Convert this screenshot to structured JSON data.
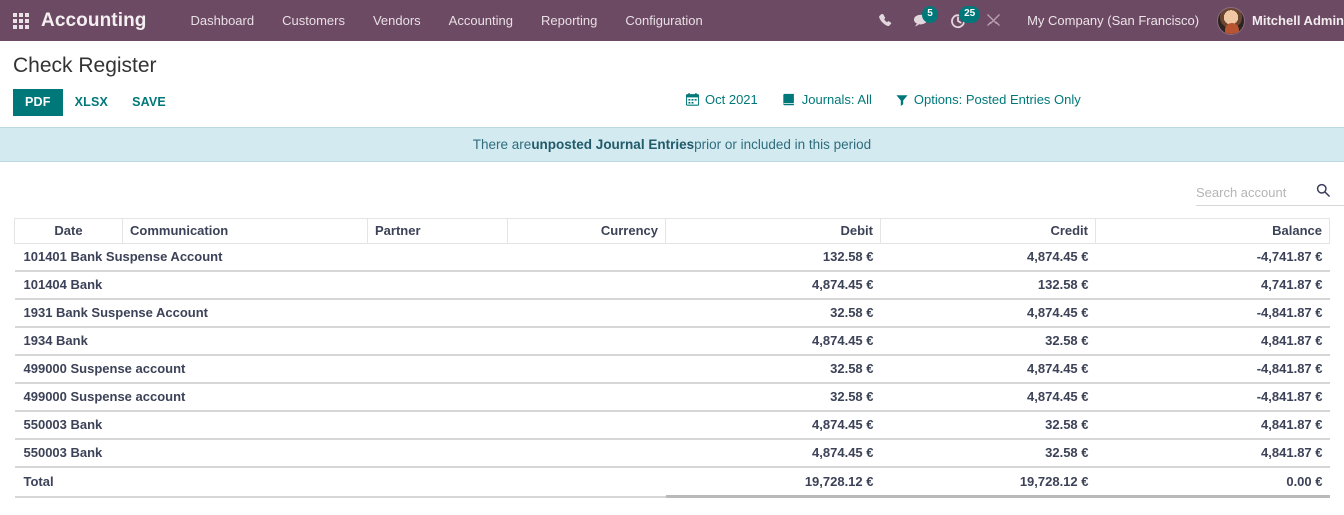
{
  "navbar": {
    "apps_icon": "apps-grid-icon",
    "brand": "Accounting",
    "menu": [
      {
        "label": "Dashboard"
      },
      {
        "label": "Customers"
      },
      {
        "label": "Vendors"
      },
      {
        "label": "Accounting"
      },
      {
        "label": "Reporting"
      },
      {
        "label": "Configuration"
      }
    ],
    "icons": {
      "phone": "phone-icon",
      "messages": "chat-icon",
      "messages_count": "5",
      "activities": "activity-clock-icon",
      "activities_count": "25",
      "tools": "wrench-screwdriver-icon"
    },
    "company": "My Company (San Francisco)",
    "user": "Mitchell Admin",
    "avatar": "user-avatar"
  },
  "page": {
    "title": "Check Register"
  },
  "toolbar": {
    "pdf_label": "PDF",
    "xlsx_label": "XLSX",
    "save_label": "SAVE"
  },
  "filters": [
    {
      "icon": "calendar-icon",
      "label": "Oct 2021"
    },
    {
      "icon": "book-icon",
      "label": "Journals: All"
    },
    {
      "icon": "filter-icon",
      "label": "Options: Posted Entries Only"
    }
  ],
  "alert": {
    "prefix": "There are ",
    "strong": "unposted Journal Entries",
    "suffix": " prior or included in this period"
  },
  "search": {
    "placeholder": "Search account",
    "value": "",
    "icon": "search-icon"
  },
  "table": {
    "headers": {
      "date": "Date",
      "communication": "Communication",
      "partner": "Partner",
      "currency": "Currency",
      "debit": "Debit",
      "credit": "Credit",
      "balance": "Balance"
    },
    "rows": [
      {
        "account": "101401 Bank Suspense Account",
        "debit": "132.58 €",
        "credit": "4,874.45 €",
        "balance": "-4,741.87 €"
      },
      {
        "account": "101404 Bank",
        "debit": "4,874.45 €",
        "credit": "132.58 €",
        "balance": "4,741.87 €"
      },
      {
        "account": "1931 Bank Suspense Account",
        "debit": "32.58 €",
        "credit": "4,874.45 €",
        "balance": "-4,841.87 €"
      },
      {
        "account": "1934 Bank",
        "debit": "4,874.45 €",
        "credit": "32.58 €",
        "balance": "4,841.87 €"
      },
      {
        "account": "499000 Suspense account",
        "debit": "32.58 €",
        "credit": "4,874.45 €",
        "balance": "-4,841.87 €"
      },
      {
        "account": "499000 Suspense account",
        "debit": "32.58 €",
        "credit": "4,874.45 €",
        "balance": "-4,841.87 €"
      },
      {
        "account": "550003 Bank",
        "debit": "4,874.45 €",
        "credit": "32.58 €",
        "balance": "4,841.87 €"
      },
      {
        "account": "550003 Bank",
        "debit": "4,874.45 €",
        "credit": "32.58 €",
        "balance": "4,841.87 €"
      }
    ],
    "total": {
      "label": "Total",
      "debit": "19,728.12 €",
      "credit": "19,728.12 €",
      "balance": "0.00 €"
    }
  },
  "colors": {
    "navbar_bg": "#6d4a63",
    "accent_teal": "#00787a",
    "alert_bg": "#d2eaf0",
    "text": "#3c4257"
  }
}
